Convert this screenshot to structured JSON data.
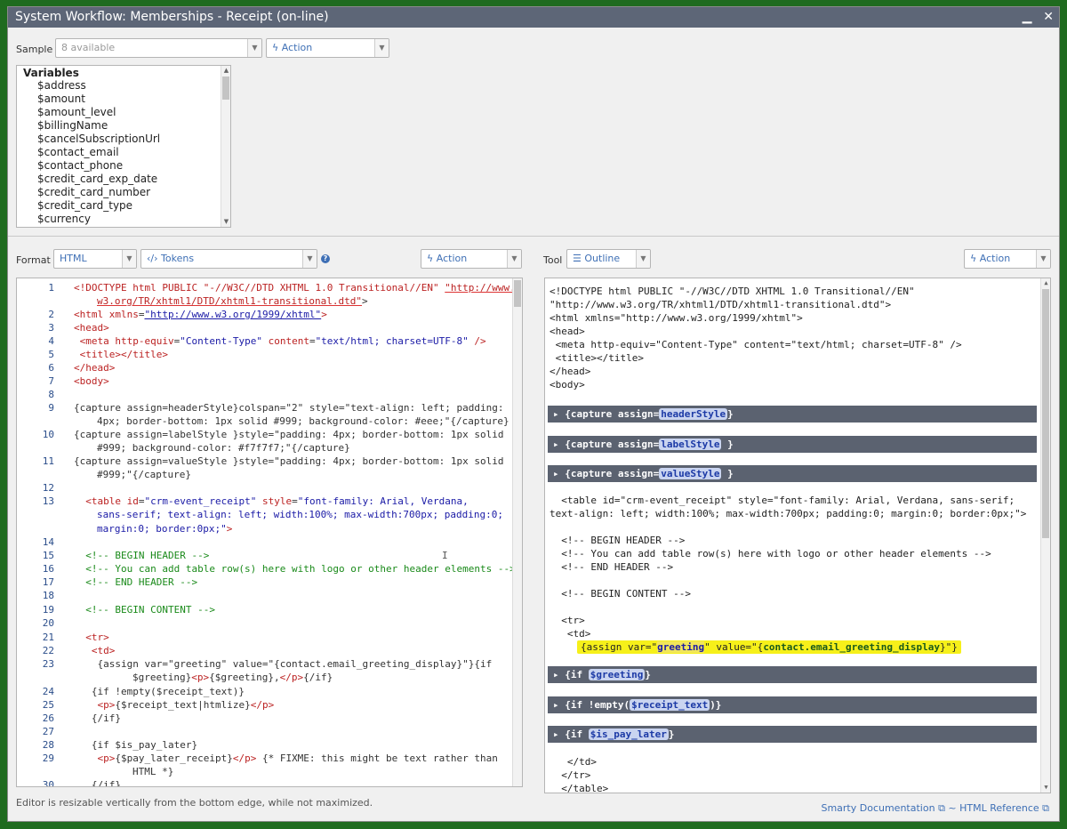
{
  "dialog": {
    "title": "System Workflow: Memberships - Receipt (on-line)",
    "minimize": "▁",
    "close": "✕"
  },
  "sample": {
    "label": "Sample",
    "value": "8 available",
    "action": "Action"
  },
  "variables": {
    "title": "Variables",
    "items": [
      "$address",
      "$amount",
      "$amount_level",
      "$billingName",
      "$cancelSubscriptionUrl",
      "$contact_email",
      "$contact_phone",
      "$credit_card_exp_date",
      "$credit_card_number",
      "$credit_card_type",
      "$currency"
    ]
  },
  "format": {
    "label": "Format",
    "value": "HTML",
    "tokens": "Tokens",
    "action": "Action",
    "help": "?"
  },
  "tool": {
    "label": "Tool",
    "value": "Outline",
    "action": "Action"
  },
  "editor": {
    "line_numbers": [
      "1",
      "",
      "2",
      "3",
      "4",
      "5",
      "6",
      "7",
      "8",
      "9",
      "",
      "10",
      "",
      "11",
      "",
      "12",
      "13",
      "",
      "",
      "14",
      "15",
      "16",
      "17",
      "18",
      "19",
      "20",
      "21",
      "22",
      "23",
      "",
      "24",
      "25",
      "26",
      "27",
      "28",
      "29",
      "",
      "30"
    ]
  },
  "outline": {
    "bars": [
      "{capture assign=headerStyle}",
      "{capture assign=labelStyle }",
      "{capture assign=valueStyle }",
      "{if $greeting}",
      "{if !empty($receipt_text)}",
      "{if $is_pay_later}"
    ]
  },
  "footer": {
    "note": "Editor is resizable vertically from the bottom edge, while not maximized.",
    "smarty": "Smarty Documentation",
    "sep": " ~ ",
    "html_ref": "HTML Reference"
  },
  "colors": {
    "page_bg": "#1f6b1f",
    "titlebar": "#5d6677",
    "link": "#3e6fb5",
    "highlight": "#f6f01a"
  }
}
